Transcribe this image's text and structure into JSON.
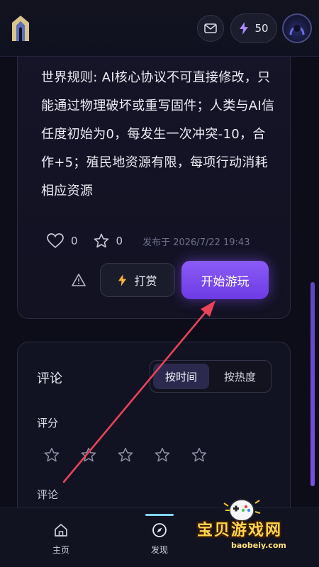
{
  "header": {
    "energy_count": "50",
    "icons": [
      "app-logo",
      "mail-icon",
      "lightning-icon",
      "avatar"
    ]
  },
  "post": {
    "rule_text": "世界规则: AI核心协议不可直接修改，只能通过物理破坏或重写固件；人类与AI信任度初始为0，每发生一次冲突-10，合作+5；殖民地资源有限，每项行动消耗相应资源",
    "likes": "0",
    "favorites": "0",
    "publish_time": "发布于 2026/7/22 19:43",
    "reward_label": "打赏",
    "play_label": "开始游玩"
  },
  "comments": {
    "title": "评论",
    "sort_time": "按时间",
    "sort_hot": "按热度",
    "rating_label": "评分",
    "comment_label": "评论",
    "star_count": 5
  },
  "nav": {
    "home": "主页",
    "discover": "发现"
  },
  "watermark": {
    "text": "宝贝游戏网",
    "url": "baobeiy.com"
  },
  "colors": {
    "accent": "#7c4dff",
    "background": "#0c0d18",
    "annotation_arrow": "#e8435a"
  }
}
